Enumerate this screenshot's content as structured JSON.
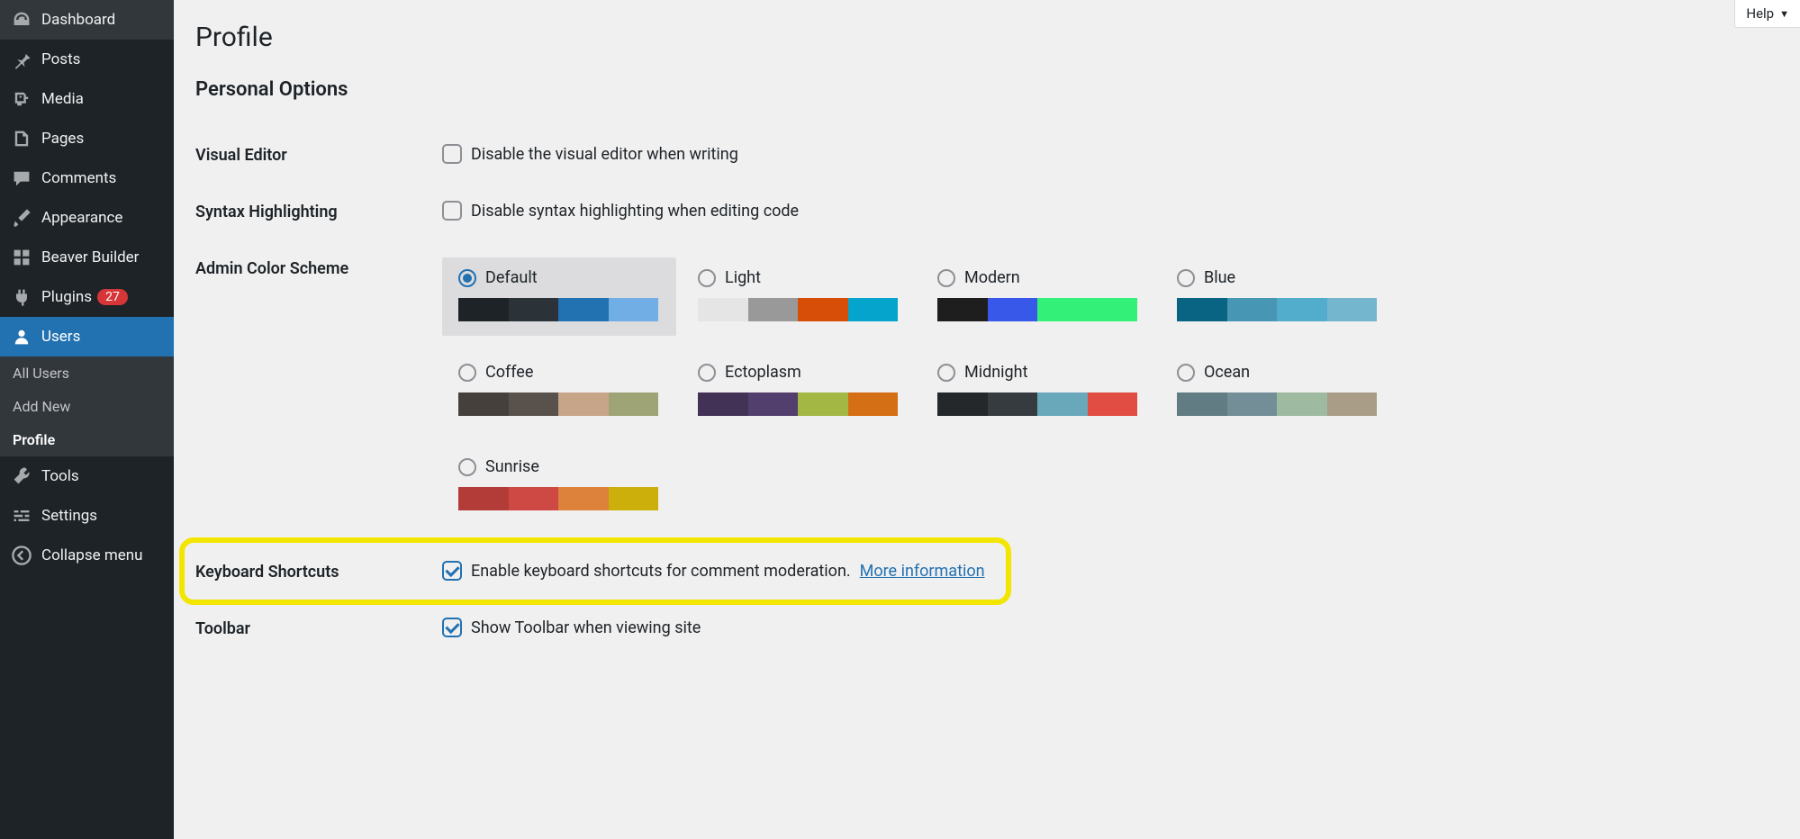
{
  "help": {
    "label": "Help"
  },
  "sidebar": {
    "items": [
      {
        "label": "Dashboard",
        "icon": "dashboard"
      },
      {
        "label": "Posts",
        "icon": "pin"
      },
      {
        "label": "Media",
        "icon": "media"
      },
      {
        "label": "Pages",
        "icon": "pages"
      },
      {
        "label": "Comments",
        "icon": "comment"
      },
      {
        "label": "Appearance",
        "icon": "brush"
      },
      {
        "label": "Beaver Builder",
        "icon": "grid"
      },
      {
        "label": "Plugins",
        "icon": "plug",
        "badge": "27"
      },
      {
        "label": "Users",
        "icon": "user",
        "active": true
      },
      {
        "label": "Tools",
        "icon": "wrench"
      },
      {
        "label": "Settings",
        "icon": "sliders"
      },
      {
        "label": "Collapse menu",
        "icon": "collapse"
      }
    ],
    "submenu": [
      {
        "label": "All Users"
      },
      {
        "label": "Add New"
      },
      {
        "label": "Profile",
        "current": true
      }
    ]
  },
  "page": {
    "title": "Profile",
    "section": "Personal Options",
    "rows": {
      "visual_editor": {
        "label": "Visual Editor",
        "check_label": "Disable the visual editor when writing"
      },
      "syntax": {
        "label": "Syntax Highlighting",
        "check_label": "Disable syntax highlighting when editing code"
      },
      "color_scheme": {
        "label": "Admin Color Scheme"
      },
      "shortcuts": {
        "label": "Keyboard Shortcuts",
        "check_label": "Enable keyboard shortcuts for comment moderation.",
        "link": "More information"
      },
      "toolbar": {
        "label": "Toolbar",
        "check_label": "Show Toolbar when viewing site"
      }
    },
    "schemes": [
      {
        "name": "Default",
        "colors": [
          "#1d2327",
          "#2c3338",
          "#2271b1",
          "#72aee6"
        ],
        "selected": true
      },
      {
        "name": "Light",
        "colors": [
          "#e5e5e5",
          "#999999",
          "#d64e07",
          "#04a4cc"
        ]
      },
      {
        "name": "Modern",
        "colors": [
          "#1e1e1e",
          "#3858e9",
          "#33f078",
          "#33f078"
        ]
      },
      {
        "name": "Blue",
        "colors": [
          "#096484",
          "#4796b3",
          "#52accc",
          "#74b6ce"
        ]
      },
      {
        "name": "Coffee",
        "colors": [
          "#46403c",
          "#59524c",
          "#c7a589",
          "#9ea476"
        ]
      },
      {
        "name": "Ectoplasm",
        "colors": [
          "#413256",
          "#523f6d",
          "#a3b745",
          "#d46f15"
        ]
      },
      {
        "name": "Midnight",
        "colors": [
          "#25282b",
          "#363b3f",
          "#69a8bb",
          "#e14d43"
        ]
      },
      {
        "name": "Ocean",
        "colors": [
          "#627c83",
          "#738e96",
          "#9ebaa0",
          "#aa9d88"
        ]
      },
      {
        "name": "Sunrise",
        "colors": [
          "#b43c38",
          "#cf4944",
          "#dd823b",
          "#ccaf0b"
        ]
      }
    ]
  }
}
